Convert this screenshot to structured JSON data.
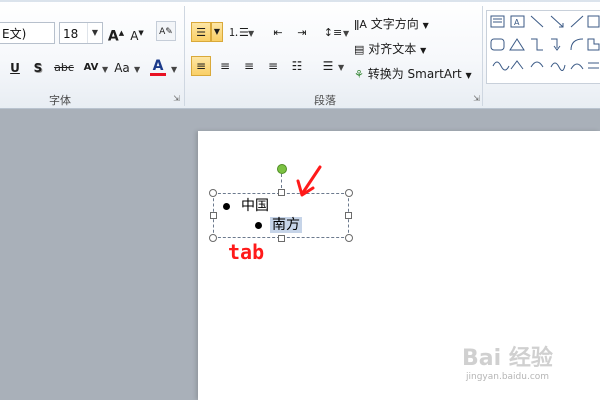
{
  "ribbon": {
    "font_group": {
      "label": "字体",
      "font_name": "E文)",
      "font_size": "18",
      "grow_font": "A",
      "shrink_font": "A",
      "underline": "U",
      "shadow": "S",
      "strike": "abc",
      "spacing": "AV",
      "change_case": "Aa",
      "font_color": "A",
      "font_color_value": "#e81123"
    },
    "paragraph_group": {
      "label": "段落",
      "text_direction": "文字方向",
      "align_text": "对齐文本",
      "convert_smartart": "转换为 SmartArt"
    }
  },
  "slide": {
    "line1": "中国",
    "line2": "南方"
  },
  "annotation": {
    "tab_label": "tab",
    "annotation_color": "#ff1a1a"
  },
  "watermark": {
    "brand": "Bai 经验",
    "url": "jingyan.baidu.com"
  }
}
